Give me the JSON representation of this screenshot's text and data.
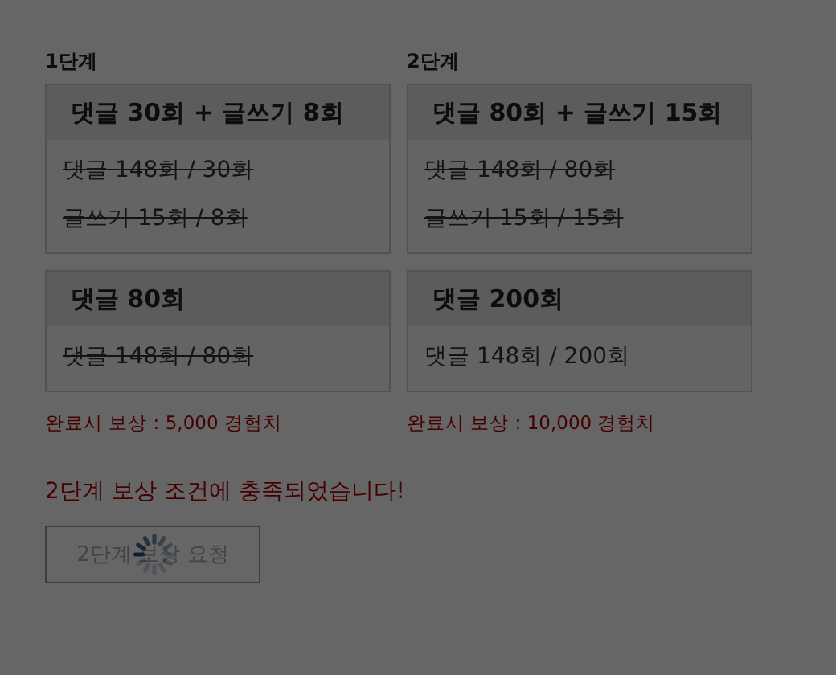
{
  "stages": [
    {
      "label": "1단계",
      "missions": [
        {
          "title": "댓글 30회 + 글쓰기 8회",
          "progress": [
            {
              "text": "댓글 148회 / 30회",
              "done": true
            },
            {
              "text": "글쓰기 15회 / 8회",
              "done": true
            }
          ]
        },
        {
          "title": "댓글 80회",
          "progress": [
            {
              "text": "댓글 148회 / 80회",
              "done": true
            }
          ]
        }
      ],
      "reward": "완료시 보상 : 5,000 경험치"
    },
    {
      "label": "2단계",
      "missions": [
        {
          "title": "댓글 80회 + 글쓰기 15회",
          "progress": [
            {
              "text": "댓글 148회 / 80회",
              "done": true
            },
            {
              "text": "글쓰기 15회 / 15회",
              "done": true
            }
          ]
        },
        {
          "title": "댓글 200회",
          "progress": [
            {
              "text": "댓글 148회 / 200회",
              "done": false
            }
          ]
        }
      ],
      "reward": "완료시 보상 : 10,000 경험치"
    }
  ],
  "message": "2단계 보상 조건에 충족되었습니다!",
  "button": {
    "label": "2단계 보상 요청",
    "disabled": true
  },
  "loading": true
}
